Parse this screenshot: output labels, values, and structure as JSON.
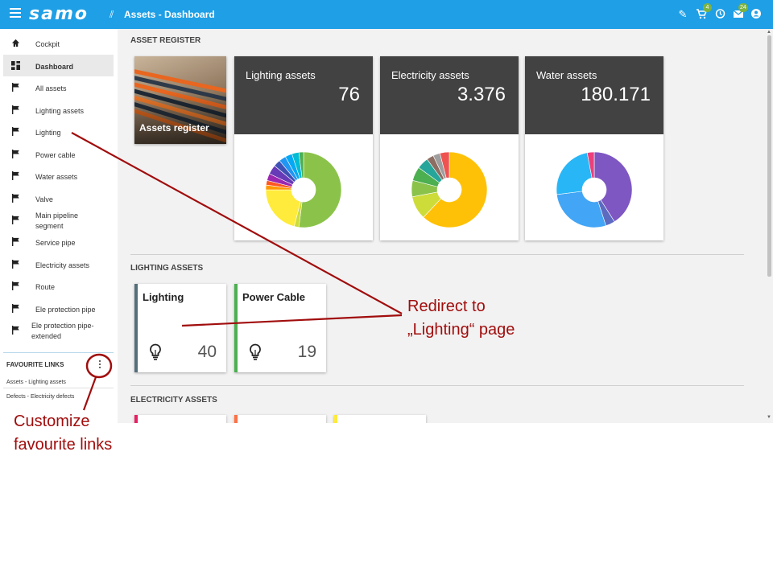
{
  "topbar": {
    "logo": "samo",
    "title": "Assets - Dashboard",
    "icons": [
      {
        "name": "edit-icon",
        "glyph": "✎"
      },
      {
        "name": "cart-icon",
        "glyph": "🛒",
        "badge": "4"
      },
      {
        "name": "history-icon",
        "glyph": "◷"
      },
      {
        "name": "mail-icon",
        "glyph": "✉",
        "badge": "24"
      },
      {
        "name": "account-icon",
        "glyph": "●"
      }
    ]
  },
  "sidebar": {
    "items": [
      {
        "label": "Cockpit",
        "icon": "home-icon"
      },
      {
        "label": "Dashboard",
        "icon": "dashboard-icon",
        "active": true
      },
      {
        "label": "All assets",
        "icon": "flag-icon"
      },
      {
        "label": "Lighting assets",
        "icon": "flag-icon"
      },
      {
        "label": "Lighting",
        "icon": "flag-icon"
      },
      {
        "label": "Power cable",
        "icon": "flag-icon"
      },
      {
        "label": "Water assets",
        "icon": "flag-icon"
      },
      {
        "label": "Valve",
        "icon": "flag-icon"
      },
      {
        "label": "Main pipeline segment",
        "icon": "flag-icon"
      },
      {
        "label": "Service pipe",
        "icon": "flag-icon"
      },
      {
        "label": "Electricity assets",
        "icon": "flag-icon"
      },
      {
        "label": "Route",
        "icon": "flag-icon"
      },
      {
        "label": "Ele protection pipe",
        "icon": "flag-icon"
      },
      {
        "label": "Ele protection pipe-extended",
        "icon": "flag-icon"
      }
    ],
    "favourites": {
      "title": "FAVOURITE LINKS",
      "links": [
        "Assets - Lighting assets",
        "Defects - Electricity defects"
      ]
    }
  },
  "main": {
    "asset_register": {
      "title": "ASSET REGISTER",
      "register_card": "Assets register",
      "cards": [
        {
          "name": "Lighting assets",
          "value": "76"
        },
        {
          "name": "Electricity assets",
          "value": "3.376"
        },
        {
          "name": "Water assets",
          "value": "180.171"
        }
      ]
    },
    "lighting_assets": {
      "title": "LIGHTING ASSETS",
      "tiles": [
        {
          "name": "Lighting",
          "count": "40",
          "color": "#546e7a"
        },
        {
          "name": "Power Cable",
          "count": "19",
          "color": "#4caf50"
        }
      ]
    },
    "electricity_assets": {
      "title": "ELECTRICITY ASSETS",
      "tile_colors": [
        "#e91e63",
        "#ff7043",
        "#ffeb3b"
      ]
    }
  },
  "chart_data": [
    {
      "type": "pie",
      "donut": true,
      "series_colors": [
        "#8bc34a",
        "#cddc39",
        "#ffeb3b",
        "#ff9800",
        "#ff5722",
        "#9c27b0",
        "#673ab7",
        "#3f51b5",
        "#2196f3",
        "#03a9f4",
        "#00bcd4",
        "#4caf50"
      ],
      "values": [
        52,
        2,
        21,
        2,
        2,
        3,
        4,
        3,
        3,
        3,
        3,
        2
      ]
    },
    {
      "type": "pie",
      "donut": true,
      "series_colors": [
        "#ffc107",
        "#cddc39",
        "#8bc34a",
        "#4caf50",
        "#26a69a",
        "#8d6e63",
        "#9e9e9e",
        "#ef5350"
      ],
      "values": [
        62,
        10,
        7,
        6,
        5,
        3,
        3,
        4
      ]
    },
    {
      "type": "pie",
      "donut": true,
      "series_colors": [
        "#7e57c2",
        "#5c6bc0",
        "#42a5f5",
        "#29b6f6",
        "#ec407a"
      ],
      "values": [
        41,
        4,
        28,
        24,
        3
      ]
    }
  ],
  "annotations": {
    "redirect": "Redirect to\n„Lighting“ page",
    "customize": "Customize\nfavourite links",
    "color": "#a10d0d"
  }
}
